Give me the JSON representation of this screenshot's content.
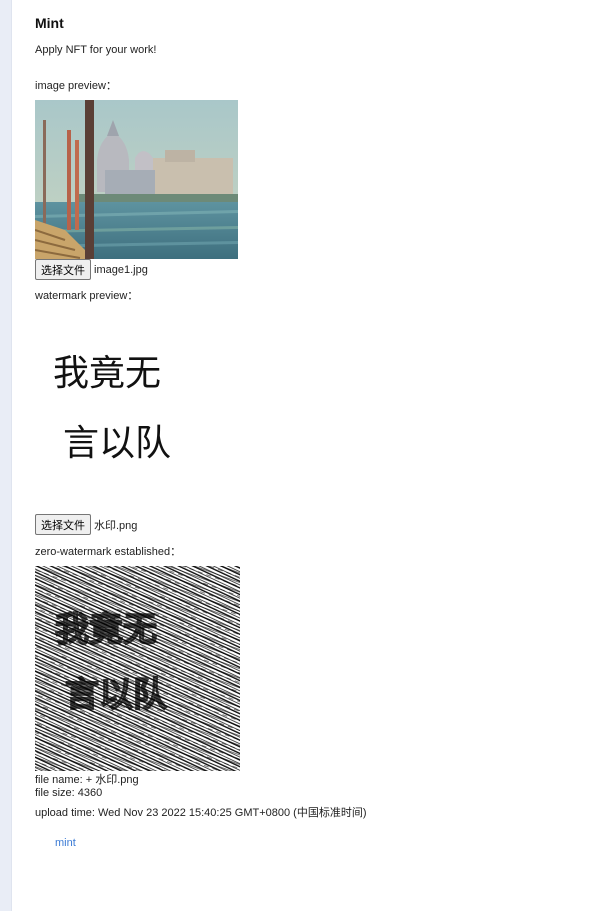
{
  "page": {
    "title": "Mint",
    "subtitle": "Apply NFT for your work!"
  },
  "image_section": {
    "label": "image preview：",
    "file_button": "选择文件",
    "file_name": "image1.jpg"
  },
  "watermark_section": {
    "label": "watermark preview：",
    "watermark_text_line1": "我竟无",
    "watermark_text_line2": "言以队",
    "file_button": "选择文件",
    "file_name": "水印.png"
  },
  "zero_watermark_section": {
    "label": "zero-watermark established："
  },
  "file_info": {
    "name": "file name: + 水印.png",
    "size": "file size: 4360",
    "upload_time": "upload time: Wed Nov 23 2022 15:40:25 GMT+0800 (中国标准时间)"
  },
  "actions": {
    "mint_label": "mint"
  },
  "colors": {
    "link": "#3b7bd5",
    "side_strip": "#e9edf6"
  }
}
